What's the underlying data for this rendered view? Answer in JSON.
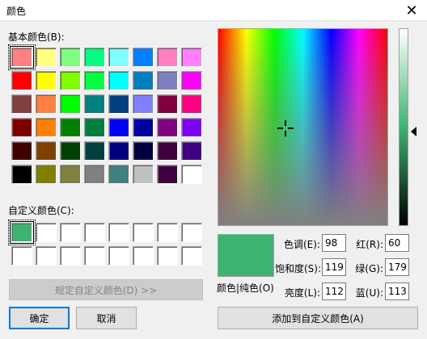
{
  "window": {
    "title": "颜色",
    "close_glyph": "✕"
  },
  "basic_colors": {
    "label": "基本颜色(B):",
    "rows": [
      [
        "#ff8080",
        "#ffff80",
        "#80ff80",
        "#00ff80",
        "#80ffff",
        "#0080ff",
        "#ff80c0",
        "#ff80ff"
      ],
      [
        "#ff0000",
        "#ffff00",
        "#80ff00",
        "#00ff40",
        "#00ffff",
        "#0080c0",
        "#8080c0",
        "#ff00ff"
      ],
      [
        "#804040",
        "#ff8040",
        "#00ff00",
        "#008080",
        "#004080",
        "#8080ff",
        "#800040",
        "#ff0080"
      ],
      [
        "#800000",
        "#ff8000",
        "#008000",
        "#008040",
        "#0000ff",
        "#0000a0",
        "#800080",
        "#8000ff"
      ],
      [
        "#400000",
        "#804000",
        "#004000",
        "#004040",
        "#000080",
        "#000040",
        "#400040",
        "#400080"
      ],
      [
        "#000000",
        "#808000",
        "#808040",
        "#808080",
        "#408080",
        "#c0c0c0",
        "#400040",
        "#ffffff"
      ]
    ]
  },
  "custom_colors": {
    "label": "自定义颜色(C):",
    "rows": [
      [
        "#3cb371",
        "#ffffff",
        "#ffffff",
        "#ffffff",
        "#ffffff",
        "#ffffff",
        "#ffffff",
        "#ffffff"
      ],
      [
        "#ffffff",
        "#ffffff",
        "#ffffff",
        "#ffffff",
        "#ffffff",
        "#ffffff",
        "#ffffff",
        "#ffffff"
      ]
    ]
  },
  "buttons": {
    "define_custom": "规定自定义颜色(D) >>",
    "ok": "确定",
    "cancel": "取消",
    "add_custom": "添加到自定义颜色(A)"
  },
  "preview": {
    "label": "颜色|纯色(O)",
    "color": "#3cb371"
  },
  "fields": {
    "hue": {
      "label": "色调(E):",
      "value": "98"
    },
    "sat": {
      "label": "饱和度(S):",
      "value": "119"
    },
    "lum": {
      "label": "亮度(L):",
      "value": "112"
    },
    "red": {
      "label": "红(R):",
      "value": "60"
    },
    "green": {
      "label": "绿(G):",
      "value": "179"
    },
    "blue": {
      "label": "蓝(U):",
      "value": "113"
    }
  }
}
